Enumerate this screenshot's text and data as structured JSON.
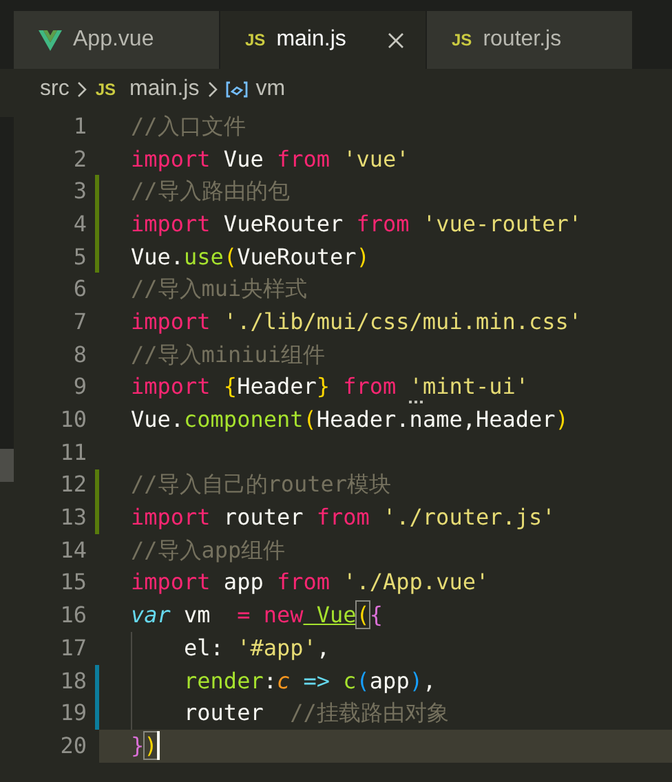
{
  "tabs": [
    {
      "label": "App.vue",
      "kind": "vue",
      "selected": false
    },
    {
      "label": "main.js",
      "kind": "js",
      "icon": "JS",
      "selected": true
    },
    {
      "label": "router.js",
      "kind": "js",
      "icon": "JS",
      "selected": false
    }
  ],
  "breadcrumb": [
    {
      "kind": "folder",
      "text": "src"
    },
    {
      "kind": "js",
      "icon": "JS",
      "text": "main.js"
    },
    {
      "kind": "symbol",
      "text": "vm"
    }
  ],
  "lines": [
    {
      "number": "1",
      "tokens": [
        {
          "kind": "comment",
          "text": "//入口文件"
        }
      ]
    },
    {
      "number": "2",
      "tokens": [
        {
          "kind": "keyword",
          "text": "import"
        },
        {
          "kind": "plain",
          "text": " Vue "
        },
        {
          "kind": "keyword",
          "text": "from"
        },
        {
          "kind": "string",
          "text": " 'vue'"
        }
      ]
    },
    {
      "number": "3",
      "color": "#587c0c",
      "tokens": [
        {
          "kind": "comment",
          "text": "//导入路由的包"
        }
      ]
    },
    {
      "number": "4",
      "color": "#587c0c",
      "tokens": [
        {
          "kind": "keyword",
          "text": "import"
        },
        {
          "kind": "plain",
          "text": " VueRouter "
        },
        {
          "kind": "keyword",
          "text": "from"
        },
        {
          "kind": "string",
          "text": " 'vue-router'"
        }
      ]
    },
    {
      "number": "5",
      "color": "#587c0c",
      "tokens": [
        {
          "kind": "plain",
          "text": "Vue."
        },
        {
          "kind": "function",
          "text": "use"
        },
        {
          "kind": "bracket1",
          "text": "("
        },
        {
          "kind": "plain",
          "text": "VueRouter"
        },
        {
          "kind": "bracket1",
          "text": ")"
        }
      ]
    },
    {
      "number": "6",
      "tokens": [
        {
          "kind": "comment",
          "text": "//导入mui央样式"
        }
      ]
    },
    {
      "number": "7",
      "tokens": [
        {
          "kind": "keyword",
          "text": "import"
        },
        {
          "kind": "string",
          "text": " './lib/mui/css/mui.min.css'"
        }
      ]
    },
    {
      "number": "8",
      "tokens": [
        {
          "kind": "comment",
          "text": "//导入miniui组件"
        }
      ]
    },
    {
      "number": "9",
      "tokens": [
        {
          "kind": "keyword",
          "text": "import"
        },
        {
          "kind": "bracket1",
          "text": " {"
        },
        {
          "kind": "plain",
          "text": "Header"
        },
        {
          "kind": "bracket1",
          "text": "}"
        },
        {
          "kind": "keyword",
          "text": " from"
        },
        {
          "kind": "string",
          "text": " 'mint-ui'",
          "hint": true
        }
      ]
    },
    {
      "number": "10",
      "tokens": [
        {
          "kind": "plain",
          "text": "Vue."
        },
        {
          "kind": "function",
          "text": "component"
        },
        {
          "kind": "bracket1",
          "text": "("
        },
        {
          "kind": "plain",
          "text": "Header.name,Header"
        },
        {
          "kind": "bracket1",
          "text": ")"
        }
      ]
    },
    {
      "number": "11"
    },
    {
      "number": "12",
      "color": "#587c0c",
      "tokens": [
        {
          "kind": "comment",
          "text": "//导入自己的router模块"
        }
      ]
    },
    {
      "number": "13",
      "color": "#587c0c",
      "tokens": [
        {
          "kind": "keyword",
          "text": "import"
        },
        {
          "kind": "plain",
          "text": " router "
        },
        {
          "kind": "keyword",
          "text": "from"
        },
        {
          "kind": "string",
          "text": " './router.js'"
        }
      ]
    },
    {
      "number": "14",
      "tokens": [
        {
          "kind": "comment",
          "text": "//导入app组件"
        }
      ]
    },
    {
      "number": "15",
      "tokens": [
        {
          "kind": "keyword",
          "text": "import"
        },
        {
          "kind": "plain",
          "text": " app "
        },
        {
          "kind": "keyword",
          "text": "from"
        },
        {
          "kind": "string",
          "text": " './App.vue'"
        }
      ]
    },
    {
      "number": "16",
      "tokens": [
        {
          "kind": "storage",
          "text": "var"
        },
        {
          "kind": "plain",
          "text": " vm  "
        },
        {
          "kind": "keyword",
          "text": "="
        },
        {
          "kind": "keyword",
          "text": " new"
        },
        {
          "kind": "function",
          "text": " Vue",
          "underline": true
        },
        {
          "kind": "bracket1",
          "text": "(",
          "matched": true
        },
        {
          "kind": "bracket2",
          "text": "{"
        }
      ]
    },
    {
      "number": "17",
      "tokens": [
        {
          "kind": "plain",
          "text": "    el: "
        },
        {
          "kind": "string",
          "text": "'#app'"
        },
        {
          "kind": "plain",
          "text": ","
        }
      ]
    },
    {
      "number": "18",
      "color": "#0c7d9d",
      "tokens": [
        {
          "kind": "function",
          "text": "    render"
        },
        {
          "kind": "plain",
          "text": ":"
        },
        {
          "kind": "param",
          "text": "c"
        },
        {
          "kind": "arrow",
          "text": " =>"
        },
        {
          "kind": "function",
          "text": " c"
        },
        {
          "kind": "bracket3",
          "text": "("
        },
        {
          "kind": "plain",
          "text": "app"
        },
        {
          "kind": "bracket3",
          "text": ")"
        },
        {
          "kind": "plain",
          "text": ","
        }
      ]
    },
    {
      "number": "19",
      "color": "#0c7d9d",
      "tokens": [
        {
          "kind": "plain",
          "text": "    router  "
        },
        {
          "kind": "comment",
          "text": "//挂载路由对象"
        }
      ]
    },
    {
      "number": "20",
      "current": true,
      "tokens": [
        {
          "kind": "bracket2",
          "text": "}"
        },
        {
          "kind": "bracket1",
          "text": ")",
          "matched": true,
          "cursor": true
        }
      ]
    }
  ]
}
